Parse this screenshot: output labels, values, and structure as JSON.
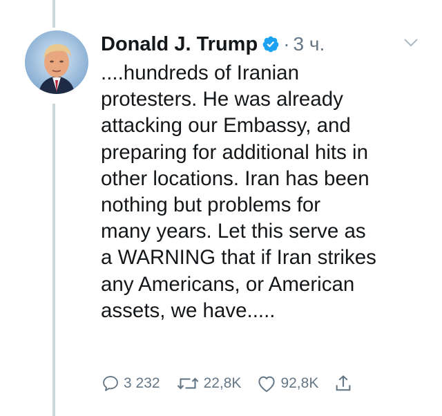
{
  "tweet": {
    "author_name": "Donald J. Trump",
    "separator": "·",
    "time": "3 ч.",
    "text": "....hundreds of Iranian\nprotesters. He was already\nattacking our Embassy, and\npreparing for additional hits in\nother locations. Iran has been\nnothing but problems for\nmany years. Let this serve as\na WARNING that if Iran strikes\nany Americans, or American\nassets, we have.....",
    "replies": "3 232",
    "retweets": "22,8K",
    "likes": "92,8K"
  },
  "colors": {
    "text": "#14171a",
    "muted": "#657786",
    "verified": "#1da1f2",
    "thread_line": "#ccd6dd"
  },
  "icons": [
    "verified-badge-icon",
    "chevron-down-icon",
    "reply-icon",
    "retweet-icon",
    "like-icon",
    "share-icon"
  ]
}
